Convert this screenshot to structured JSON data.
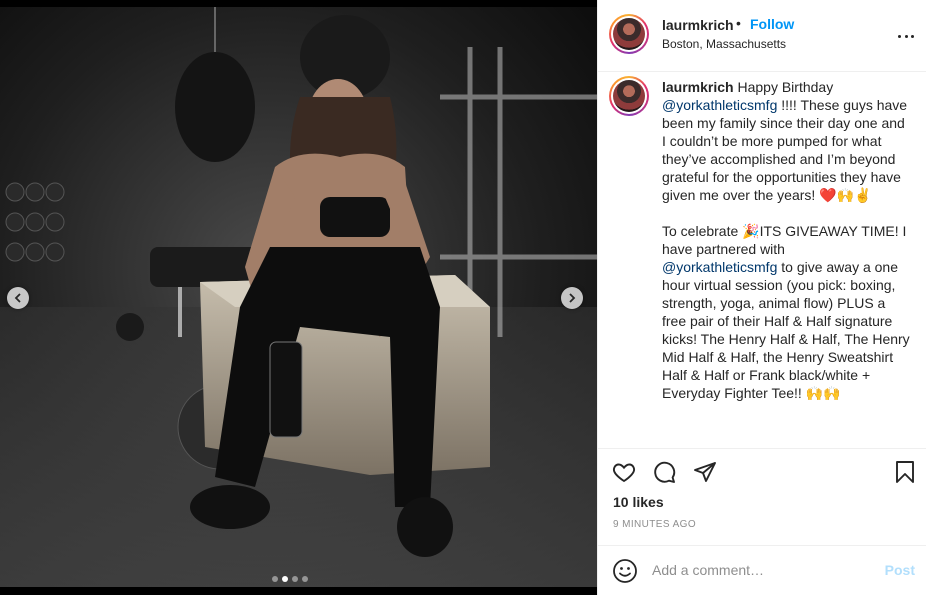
{
  "post": {
    "username": "laurmkrich",
    "follow_label": "Follow",
    "bullet": "•",
    "location": "Boston, Massachusetts",
    "more_icon": "more-horizontal-icon"
  },
  "caption": {
    "username": "laurmkrich",
    "part1": " Happy Birthday\n",
    "mention1": "@yorkathleticsmfg",
    "part2": " !!!! These guys have been my family since their day one and I couldn’t be more pumped for what they’ve accomplished and I’m beyond grateful for the opportunities they have given me over the years! ❤️🙌✌️\n\nTo celebrate 🎉ITS GIVEAWAY TIME! I have partnered with\n",
    "mention2": "@yorkathleticsmfg",
    "part3": " to give away a one hour virtual session (you pick: boxing, strength, yoga, animal flow) PLUS a free pair of their Half & Half signature kicks! The Henry Half & Half, The Henry Mid Half & Half, the Henry Sweatshirt Half & Half or Frank black/white + Everyday Fighter Tee!! 🙌🙌"
  },
  "actions": {
    "icons": [
      "heart-icon",
      "comment-icon",
      "share-icon",
      "bookmark-icon"
    ]
  },
  "likes_text": "10 likes",
  "timestamp": "9 minutes ago",
  "comment_box": {
    "placeholder": "Add a comment…",
    "post_label": "Post"
  },
  "carousel": {
    "total": 4,
    "active_index": 1
  },
  "colors": {
    "accent": "#0095f6",
    "post_disabled": "#b2dffc",
    "mention": "#00376b",
    "muted": "#8e8e8e"
  }
}
